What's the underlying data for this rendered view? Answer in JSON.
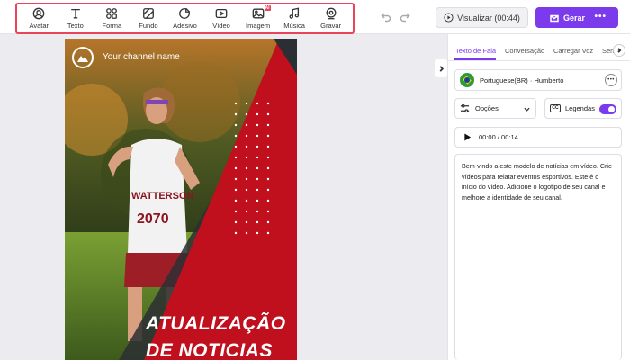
{
  "toolbar": {
    "tools": [
      {
        "label": "Avatar",
        "icon": "avatar-icon"
      },
      {
        "label": "Texto",
        "icon": "text-icon"
      },
      {
        "label": "Forma",
        "icon": "shapes-icon"
      },
      {
        "label": "Fundo",
        "icon": "background-icon"
      },
      {
        "label": "Adesivo",
        "icon": "sticker-icon"
      },
      {
        "label": "Vídeo",
        "icon": "video-icon"
      },
      {
        "label": "Imagem",
        "icon": "image-icon",
        "badge": "AI"
      },
      {
        "label": "Música",
        "icon": "music-icon"
      },
      {
        "label": "Gravar",
        "icon": "record-icon"
      }
    ],
    "preview_label": "Visualizar (00:44)",
    "save_label": "Gerar",
    "more_label": "•••"
  },
  "canvas": {
    "channel_name": "Your channel name",
    "headline_line1": "ATUALIZAÇÃO",
    "headline_line2": "DE NOTICIAS",
    "bib_text": "WATTERSON",
    "bib_number": "2070"
  },
  "panel": {
    "tabs": [
      "Texto de Fala",
      "Conversação",
      "Carregar Voz",
      "Sem"
    ],
    "voice": "Portuguese(BR) · Humberto",
    "options_label": "Opções",
    "captions_label": "Legendas",
    "captions_enabled": true,
    "cc_icon_text": "CC",
    "time": "00:00 / 00:14",
    "script": "Bem-vindo a este modelo de notícias em vídeo. Crie vídeos para relatar eventos esportivos. Este é o início do vídeo. Adicione o logotipo de seu canal e melhore a identidade de seu canal."
  },
  "colors": {
    "accent": "#7c3aed",
    "highlight": "#e8445a",
    "canvas_red": "#c0101e"
  }
}
